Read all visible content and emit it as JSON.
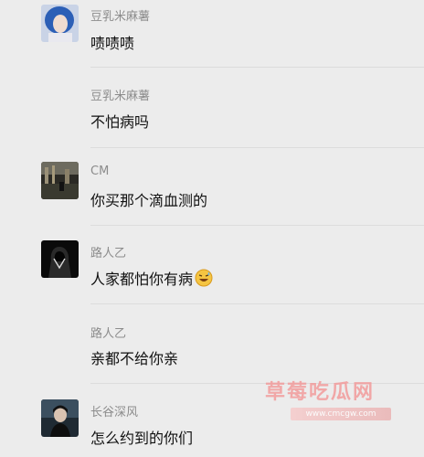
{
  "messages": [
    {
      "name": "豆乳米麻薯",
      "text": "啧啧啧"
    },
    {
      "name": "豆乳米麻薯",
      "text": "不怕病吗"
    },
    {
      "name": "CM",
      "text": "你买那个滴血测的"
    },
    {
      "name": "路人乙",
      "text": "人家都怕你有病",
      "emoji": "sweat-laugh-emoji"
    },
    {
      "name": "路人乙",
      "text": "亲都不给你亲"
    },
    {
      "name": "长谷深风",
      "text": "怎么约到的你们"
    }
  ],
  "watermark": {
    "title": "草莓吃瓜网",
    "url": "www.cmcgw.com"
  },
  "colors": {
    "background": "#ececec",
    "name_text": "#8c8c8c",
    "message_text": "#111111",
    "watermark": "#f29b9b"
  }
}
